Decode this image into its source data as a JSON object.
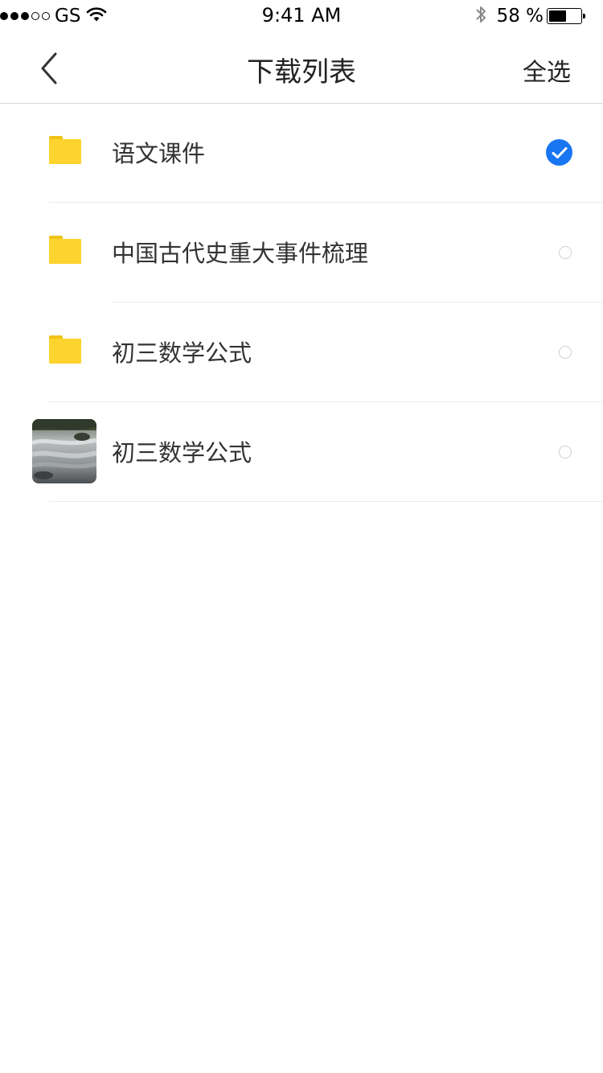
{
  "status_bar": {
    "carrier": "GS",
    "time": "9:41 AM",
    "battery_percent": "58 %",
    "battery_level": 0.58,
    "signal_dots_filled": 3,
    "signal_dots_total": 5
  },
  "nav": {
    "title": "下载列表",
    "select_all_label": "全选",
    "back_icon": "chevron-left-icon"
  },
  "colors": {
    "accent": "#1976f2",
    "folder": "#fdd32d",
    "divider": "#ececec"
  },
  "items": [
    {
      "type": "folder",
      "icon": "folder-icon",
      "label": "语文课件",
      "selected": true
    },
    {
      "type": "folder",
      "icon": "folder-icon",
      "label": "中国古代史重大事件梳理",
      "selected": false
    },
    {
      "type": "folder",
      "icon": "folder-icon",
      "label": "初三数学公式",
      "selected": false
    },
    {
      "type": "image",
      "icon": "image-thumbnail",
      "label": "初三数学公式",
      "selected": false
    }
  ]
}
